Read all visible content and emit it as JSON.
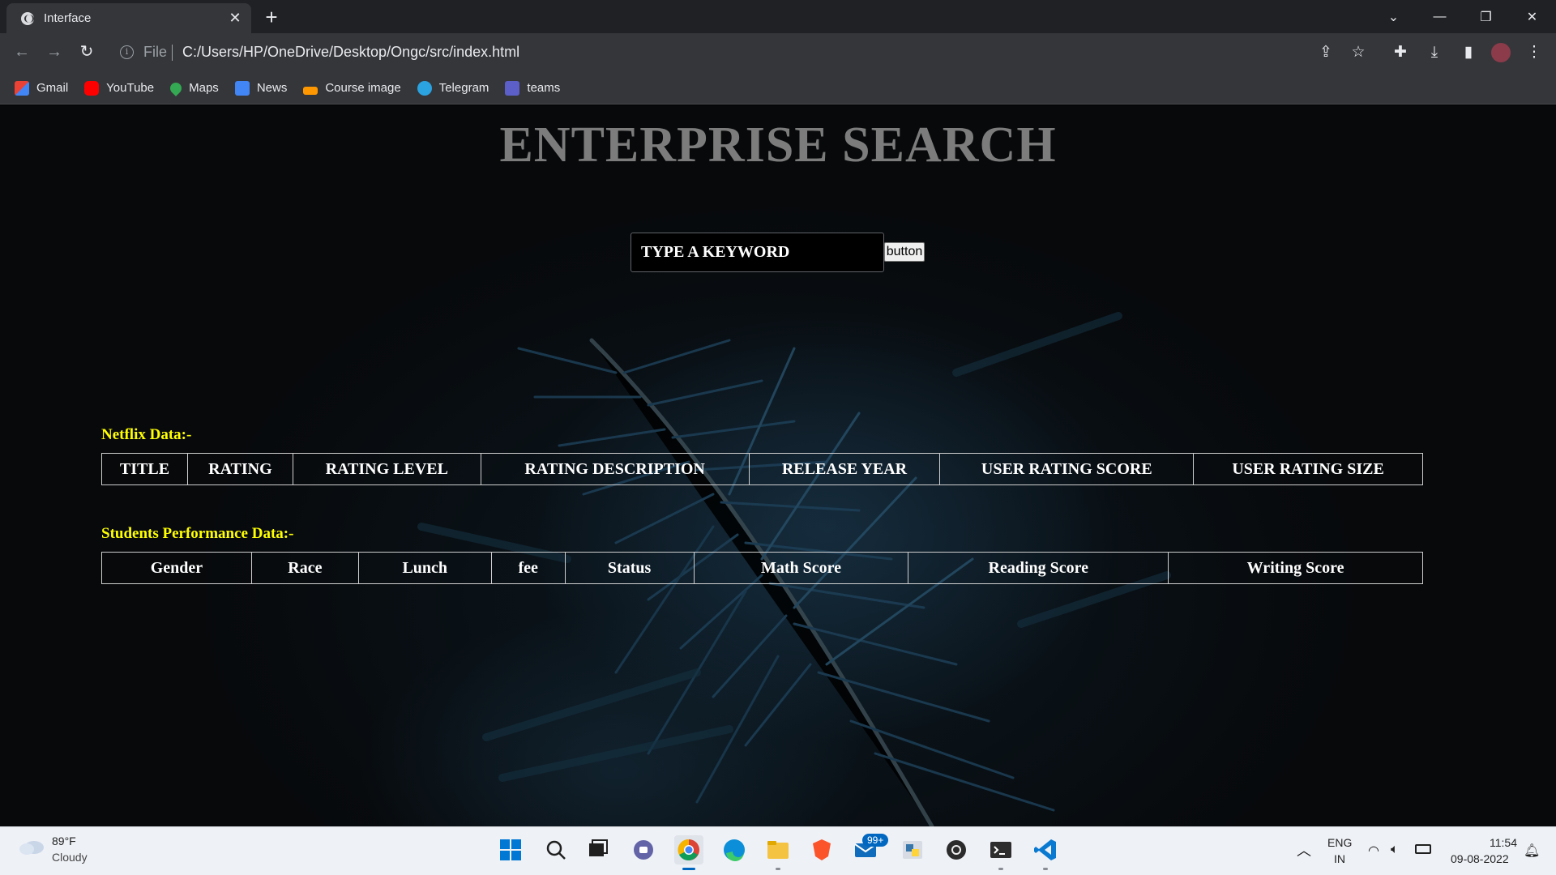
{
  "browser": {
    "tab_title": "Interface",
    "omnibox_scheme": "File",
    "url": "C:/Users/HP/OneDrive/Desktop/Ongc/src/index.html",
    "bookmarks": [
      "Gmail",
      "YouTube",
      "Maps",
      "News",
      "Course image",
      "Telegram",
      "teams"
    ]
  },
  "page": {
    "title": "ENTERPRISE SEARCH",
    "search": {
      "placeholder": "TYPE A KEYWORD",
      "button_label": "button"
    },
    "netflix": {
      "label": "Netflix Data:-",
      "columns": [
        "TITLE",
        "RATING",
        "RATING LEVEL",
        "RATING DESCRIPTION",
        "RELEASE YEAR",
        "USER RATING SCORE",
        "USER RATING SIZE"
      ]
    },
    "students": {
      "label": "Students Performance Data:-",
      "columns": [
        "Gender",
        "Race",
        "Lunch",
        "fee",
        "Status",
        "Math Score",
        "Reading Score",
        "Writing Score"
      ]
    }
  },
  "taskbar": {
    "weather_temp": "89°F",
    "weather_condition": "Cloudy",
    "mail_badge": "99+",
    "language_top": "ENG",
    "language_bottom": "IN",
    "time": "11:54",
    "date": "09-08-2022"
  },
  "colors": {
    "section_label": "#ffff00",
    "title_gray": "#7c7c7c",
    "accent_blue": "#0067c0"
  }
}
